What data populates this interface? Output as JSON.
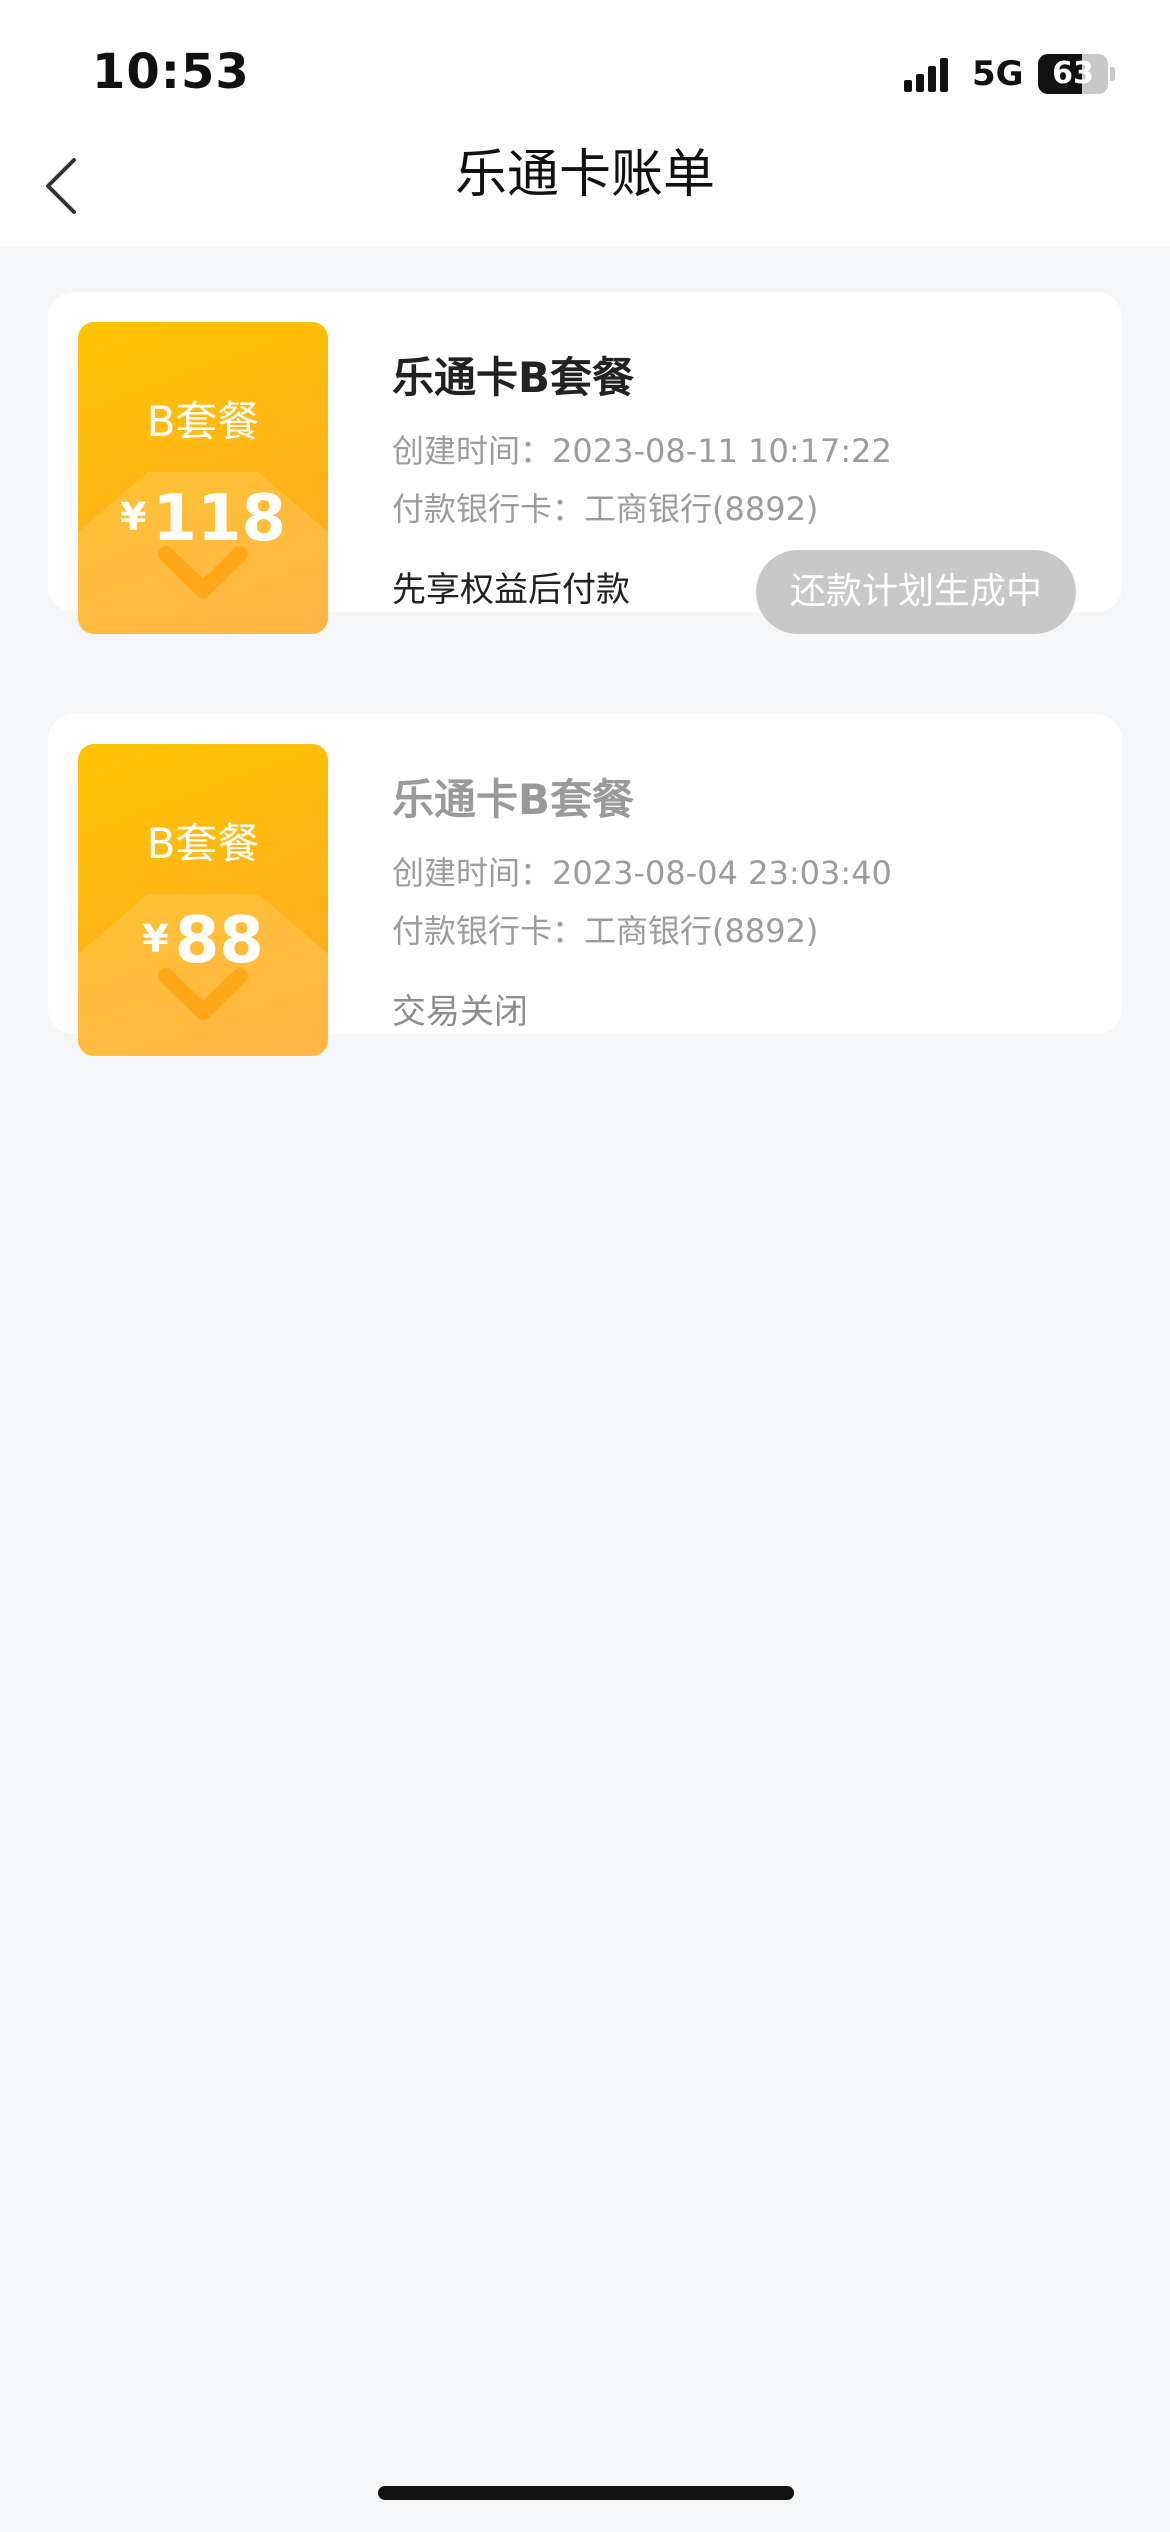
{
  "status_bar": {
    "time": "10:53",
    "network": "5G",
    "battery": "63",
    "battery_level": 0.63
  },
  "header": {
    "title": "乐通卡账单"
  },
  "bills": [
    {
      "thumb_plan": "B套餐",
      "currency": "¥",
      "amount": "118",
      "title": "乐通卡B套餐",
      "created": "创建时间：2023-08-11 10:17:22",
      "bank": "付款银行卡：工商银行(8892)",
      "status": "先享权益后付款",
      "action": "还款计划生成中"
    },
    {
      "thumb_plan": "B套餐",
      "currency": "¥",
      "amount": "88",
      "title": "乐通卡B套餐",
      "created": "创建时间：2023-08-04 23:03:40",
      "bank": "付款银行卡：工商银行(8892)",
      "status": "交易关闭"
    }
  ],
  "icons": {
    "back": "chevron-left-icon",
    "signal": "signal-icon",
    "battery": "battery-icon"
  },
  "colors": {
    "accent": "#ffb31a",
    "background": "#f5f6f8",
    "disabled_button": "#c8c8c8"
  }
}
